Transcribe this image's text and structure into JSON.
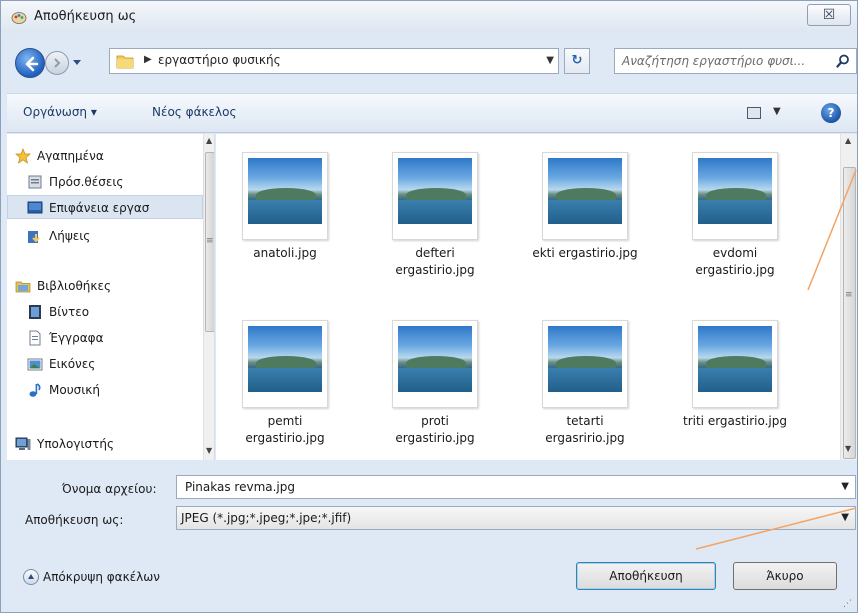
{
  "window": {
    "title": "Αποθήκευση ως",
    "close_glyph": "☒"
  },
  "address": {
    "path": "εργαστήριο φυσικής",
    "refresh_glyph": "↻",
    "search_placeholder": "Αναζήτηση εργαστήριο φυσι..."
  },
  "toolbar": {
    "organize_label": "Οργάνωση ▾",
    "new_folder_label": "Νέος φάκελος",
    "help_glyph": "?"
  },
  "nav": {
    "items": [
      {
        "label": "Αγαπημένα",
        "icon": "star-icon"
      },
      {
        "label": "Πρόσ.θέσεις",
        "icon": "recent-places-icon"
      },
      {
        "label": "Επιφάνεια εργασ",
        "icon": "desktop-icon"
      },
      {
        "label": "Λήψεις",
        "icon": "downloads-icon"
      },
      {
        "label": "Βιβλιοθήκες",
        "icon": "libraries-icon"
      },
      {
        "label": "Βίντεο",
        "icon": "video-icon"
      },
      {
        "label": "Έγγραφα",
        "icon": "documents-icon"
      },
      {
        "label": "Εικόνες",
        "icon": "pictures-icon"
      },
      {
        "label": "Μουσική",
        "icon": "music-icon"
      },
      {
        "label": "Υπολογιστής",
        "icon": "computer-icon"
      }
    ]
  },
  "files": [
    {
      "name_line1": "anatoli.jpg",
      "name_line2": ""
    },
    {
      "name_line1": "defteri",
      "name_line2": "ergastirio.jpg"
    },
    {
      "name_line1": "ekti ergastirio.jpg",
      "name_line2": ""
    },
    {
      "name_line1": "evdomi",
      "name_line2": "ergastirio.jpg"
    },
    {
      "name_line1": "pemti",
      "name_line2": "ergastirio.jpg"
    },
    {
      "name_line1": "proti",
      "name_line2": "ergastirio.jpg"
    },
    {
      "name_line1": "tetarti",
      "name_line2": "ergasririo.jpg"
    },
    {
      "name_line1": "triti ergastirio.jpg",
      "name_line2": ""
    }
  ],
  "form": {
    "filename_label": "Όνομα αρχείου:",
    "filename_value": "Pinakas revma.jpg",
    "savetype_label": "Αποθήκευση ως:",
    "savetype_value": "JPEG (*.jpg;*.jpeg;*.jpe;*.jfif)"
  },
  "footer": {
    "hide_folders_label": "Απόκρυψη φακέλων",
    "save_button": "Αποθήκευση",
    "cancel_button": "Άκυρο"
  },
  "colors": {
    "annotation_line": "#f2a466",
    "accent_blue": "#1e5fbf"
  }
}
